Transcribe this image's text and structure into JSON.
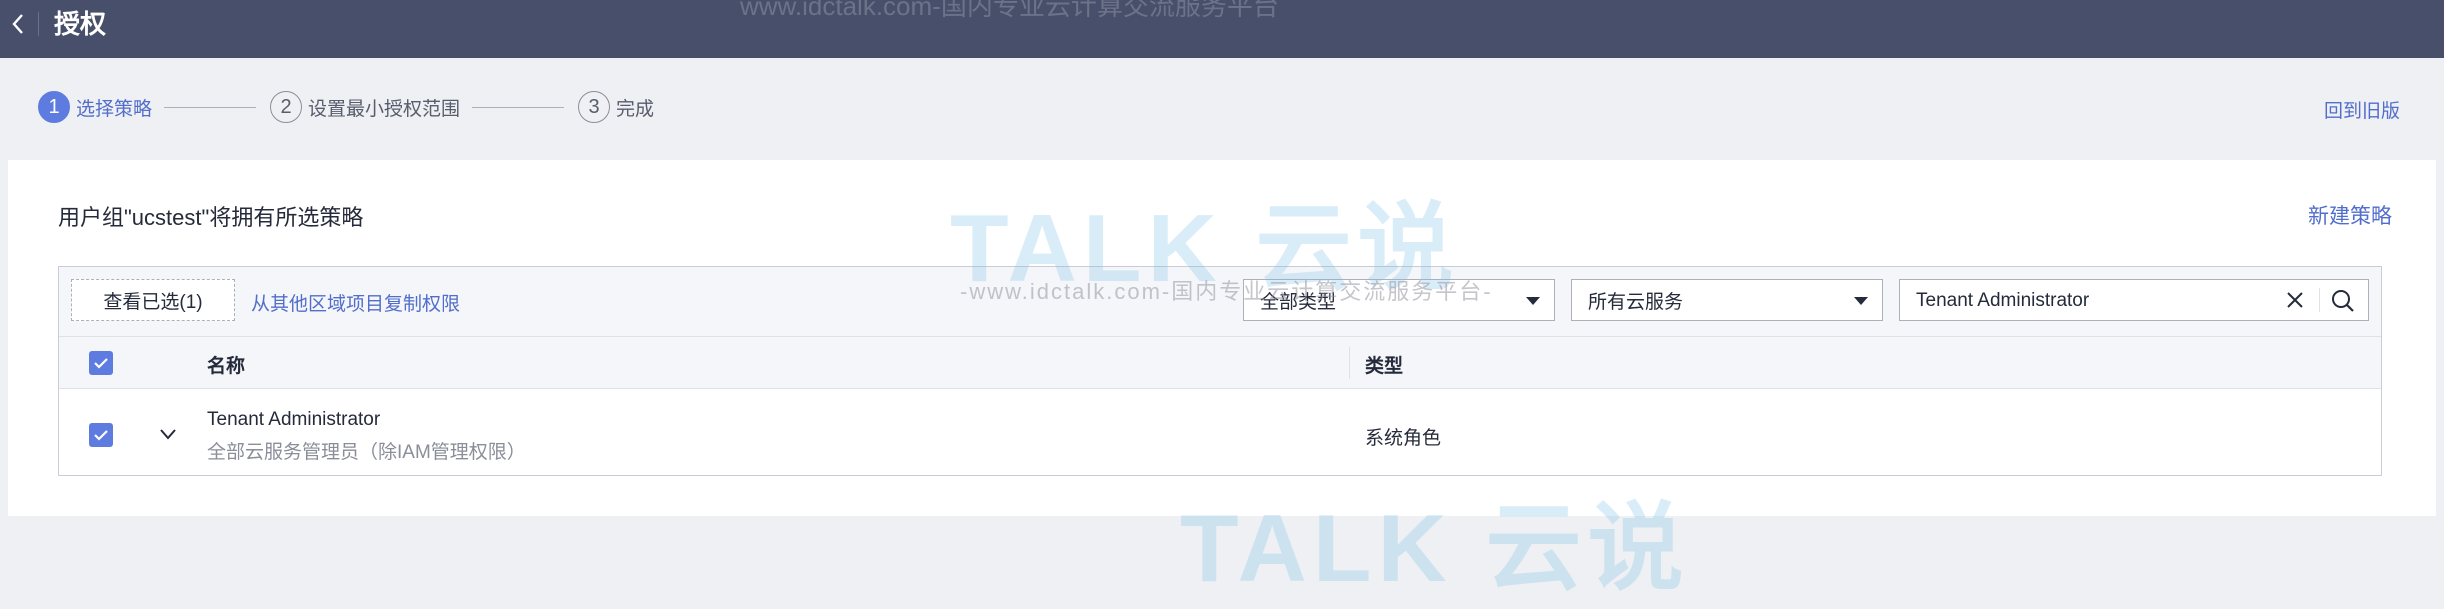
{
  "header": {
    "title": "授权"
  },
  "steps": [
    {
      "number": "1",
      "label": "选择策略"
    },
    {
      "number": "2",
      "label": "设置最小授权范围"
    },
    {
      "number": "3",
      "label": "完成"
    }
  ],
  "old_version_link": "回到旧版",
  "card": {
    "title": "用户组\"ucstest\"将拥有所选策略",
    "new_policy_link": "新建策略"
  },
  "toolbar": {
    "view_selected": "查看已选(1)",
    "copy_permissions": "从其他区域项目复制权限",
    "type_filter": "全部类型",
    "service_filter": "所有云服务",
    "search_value": "Tenant Administrator"
  },
  "table": {
    "columns": [
      "名称",
      "类型"
    ],
    "rows": [
      {
        "name": "Tenant Administrator",
        "description": "全部云服务管理员（除IAM管理权限）",
        "type": "系统角色"
      }
    ]
  },
  "watermark": {
    "logo": "TALK 云说",
    "text": "-www.idctalk.com-国内专业云计算交流服务平台-",
    "top_text": "www.idctalk.com-国内专业云计算交流服务平台"
  },
  "colors": {
    "accent": "#5e7ce0",
    "link": "#526ecc",
    "header_bg": "#484f6a"
  }
}
